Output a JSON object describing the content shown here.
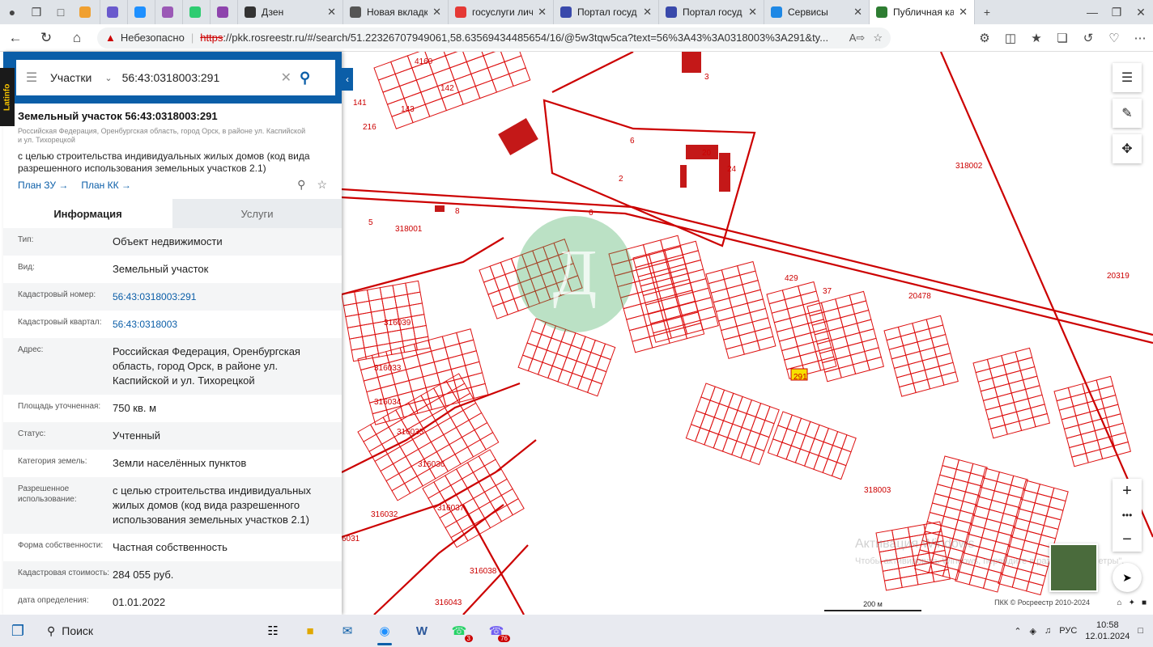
{
  "browser": {
    "tabs": [
      {
        "label": "",
        "color": "#f0a030"
      },
      {
        "label": "",
        "color": "#6a5acd"
      },
      {
        "label": "",
        "color": "#1e90ff"
      },
      {
        "label": "",
        "color": "#9b59b6"
      },
      {
        "label": "",
        "color": "#2ecc71"
      },
      {
        "label": "",
        "color": "#8e44ad"
      },
      {
        "label": "Дзен",
        "color": "#333333"
      },
      {
        "label": "Новая вкладк",
        "color": "#555555"
      },
      {
        "label": "госуслуги лич",
        "color": "#e53935"
      },
      {
        "label": "Портал госуд",
        "color": "#3949ab"
      },
      {
        "label": "Портал госуд",
        "color": "#3949ab"
      },
      {
        "label": "Сервисы",
        "color": "#1e88e5"
      },
      {
        "label": "Публичная ка",
        "color": "#2e7d32"
      }
    ],
    "security_label": "Небезопасно",
    "url_scheme": "https",
    "url_rest": "://pkk.rosreestr.ru/#/search/51.22326707949061,58.63569434485654/16/@5w3tqw5ca?text=56%3A43%3A0318003%3A291&ty..."
  },
  "search": {
    "kind": "Участки",
    "query": "56:43:0318003:291"
  },
  "latinfo": "Latinfo",
  "object": {
    "title": "Земельный участок 56:43:0318003:291",
    "address": "Российская Федерация, Оренбургская область, город Орск, в районе ул. Каспийской и ул. Тихорецкой",
    "purpose": "с целью строительства индивидуальных жилых домов (код вида разрешенного использования земельных участков 2.1)",
    "plan_zu": "План ЗУ →",
    "plan_kk": "План КК →"
  },
  "tabs": {
    "info": "Информация",
    "services": "Услуги"
  },
  "rows": [
    {
      "label": "Тип:",
      "value": "Объект недвижимости"
    },
    {
      "label": "Вид:",
      "value": "Земельный участок"
    },
    {
      "label": "Кадастровый номер:",
      "value": "56:43:0318003:291",
      "link": true
    },
    {
      "label": "Кадастровый квартал:",
      "value": "56:43:0318003",
      "link": true
    },
    {
      "label": "Адрес:",
      "value": "Российская Федерация, Оренбургская область, город Орск, в районе ул. Каспийской и ул. Тихорецкой"
    },
    {
      "label": "Площадь уточненная:",
      "value": "750 кв. м"
    },
    {
      "label": "Статус:",
      "value": "Учтенный"
    },
    {
      "label": "Категория земель:",
      "value": "Земли населённых пунктов"
    },
    {
      "label": "Разрешенное использование:",
      "value": "с целью строительства индивидуальных жилых домов (код вида разрешенного использования земельных участков 2.1)"
    },
    {
      "label": "Форма собственности:",
      "value": "Частная собственность"
    },
    {
      "label": "Кадастровая стоимость:",
      "value": "284 055 руб."
    },
    {
      "label": "дата определения:",
      "value": "01.01.2022"
    }
  ],
  "map": {
    "labels": [
      "4160",
      "142",
      "141",
      "143",
      "216",
      "6",
      "3",
      "318002",
      "2",
      "20",
      "24",
      "5",
      "318001",
      "8",
      "6",
      "429",
      "37",
      "20478",
      "20319",
      "316039",
      "316033",
      "316034",
      "316035",
      "316036",
      "316037",
      "316032",
      "316038",
      "316043",
      "6031",
      "318003",
      "291"
    ],
    "scale": "200 м",
    "copyright": "ПКК © Росреестр 2010-2024",
    "watermark1": "Активация Windows",
    "watermark2": "Чтобы активировать Windows, перейдите в раздел \"Параметры\"."
  },
  "taskbar": {
    "search": "Поиск",
    "lang": "РУС",
    "time": "10:58",
    "date": "12.01.2024",
    "whatsapp_badge": "3",
    "viber_badge": "76"
  }
}
